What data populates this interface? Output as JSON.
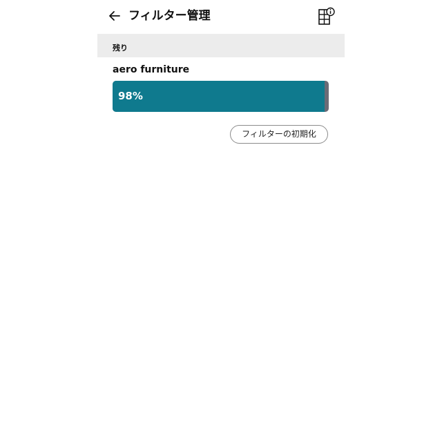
{
  "header": {
    "title": "フィルター管理",
    "back_icon": "arrow-left-icon",
    "info_icon": "filter-grid-info-icon"
  },
  "section": {
    "label": "残り"
  },
  "filter": {
    "name": "aero furniture",
    "remaining_percent": 98,
    "remaining_label": "98%"
  },
  "actions": {
    "reset_label": "フィルターの初期化"
  },
  "colors": {
    "progress_fill": "#0f7a8e",
    "progress_track": "#6b6b76",
    "section_bg": "#ececec",
    "text": "#111111"
  }
}
